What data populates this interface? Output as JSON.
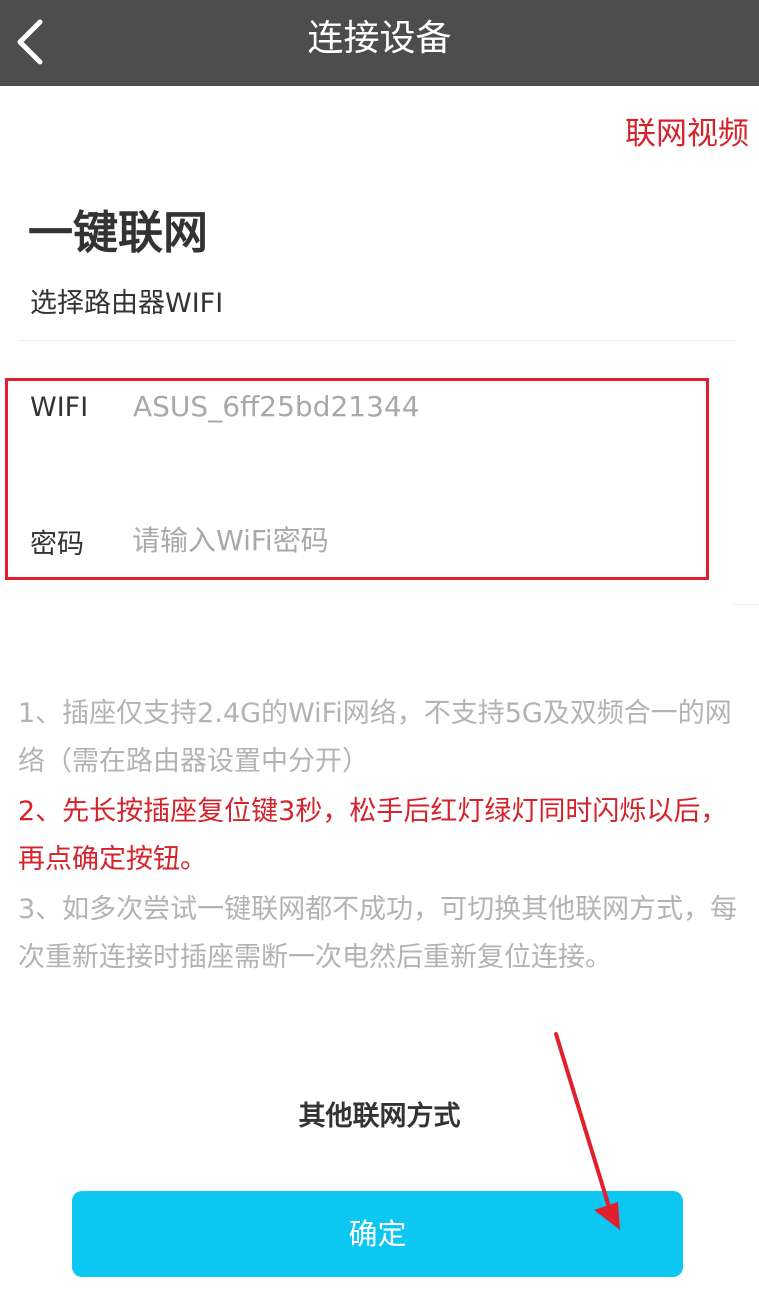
{
  "header": {
    "title": "连接设备"
  },
  "video_link": "联网视频",
  "section": {
    "title": "一键联网",
    "subtitle": "选择路由器WIFI"
  },
  "form": {
    "wifi_label": "WIFI",
    "wifi_value": "ASUS_6ff25bd21344",
    "password_label": "密码",
    "password_placeholder": "请输入WiFi密码"
  },
  "notes": [
    "1、插座仅支持2.4G的WiFi网络，不支持5G及双频合一的网络（需在路由器设置中分开）",
    "2、先长按插座复位键3秒，松手后红灯绿灯同时闪烁以后，再点确定按钮。",
    "3、如多次尝试一键联网都不成功，可切换其他联网方式，每次重新连接时插座需断一次电然后重新复位连接。"
  ],
  "other_methods": "其他联网方式",
  "confirm_label": "确定",
  "colors": {
    "header_bg": "#4d4d4d",
    "accent_red": "#d6222a",
    "highlight_box": "#e0202d",
    "button_bg": "#0dc7f3",
    "muted_text": "#b3b3b3"
  },
  "icons": {
    "back": "chevron-left-icon",
    "annotation": "arrow-annotation-icon"
  }
}
